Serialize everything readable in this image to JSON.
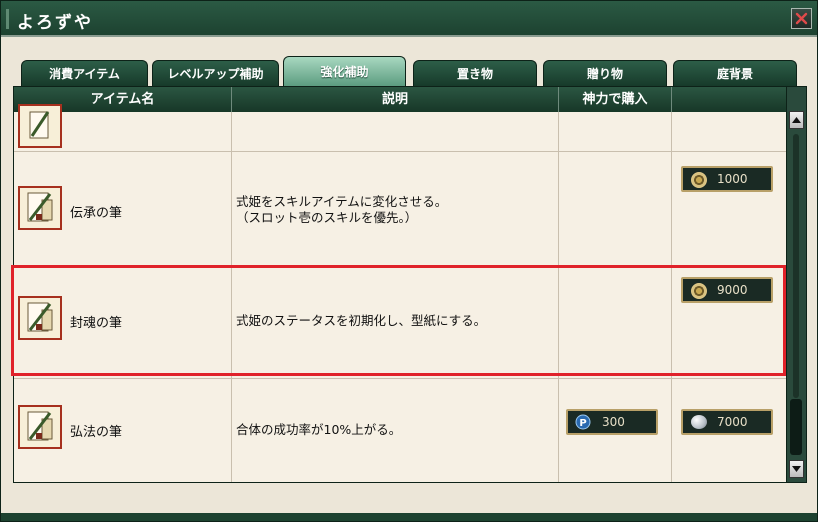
{
  "window": {
    "title": "よろずや",
    "close_label": "×"
  },
  "tabs": [
    {
      "label": "消費アイテム",
      "active": false
    },
    {
      "label": "レベルアップ補助",
      "active": false
    },
    {
      "label": "強化補助",
      "active": true
    },
    {
      "label": "置き物",
      "active": false
    },
    {
      "label": "贈り物",
      "active": false
    },
    {
      "label": "庭背景",
      "active": false
    }
  ],
  "table": {
    "headers": [
      "アイテム名",
      "説明",
      "神力で購入",
      ""
    ],
    "rows": [
      {
        "name": "",
        "description": "",
        "shinryoku_price": "",
        "coin_price": ""
      },
      {
        "name": "伝承の筆",
        "description": "式姫をスキルアイテムに変化させる。\n（スロット壱のスキルを優先。）",
        "shinryoku_price": "",
        "coin_price": "1000"
      },
      {
        "name": "封魂の筆",
        "description": "式姫のステータスを初期化し、型紙にする。",
        "shinryoku_price": "",
        "coin_price": "9000"
      },
      {
        "name": "弘法の筆",
        "description": "合体の成功率が10%上がる。",
        "shinryoku_price": "300",
        "coin_price": "7000"
      }
    ]
  },
  "icons": {
    "item": "brush-scroll-icon",
    "coin": "coin-icon",
    "pearl": "pearl-icon",
    "shinryoku": "p-point-icon"
  },
  "colors": {
    "highlight": "#e0222a",
    "active_tab": "#7fbfa0",
    "header": "#1e4534"
  }
}
